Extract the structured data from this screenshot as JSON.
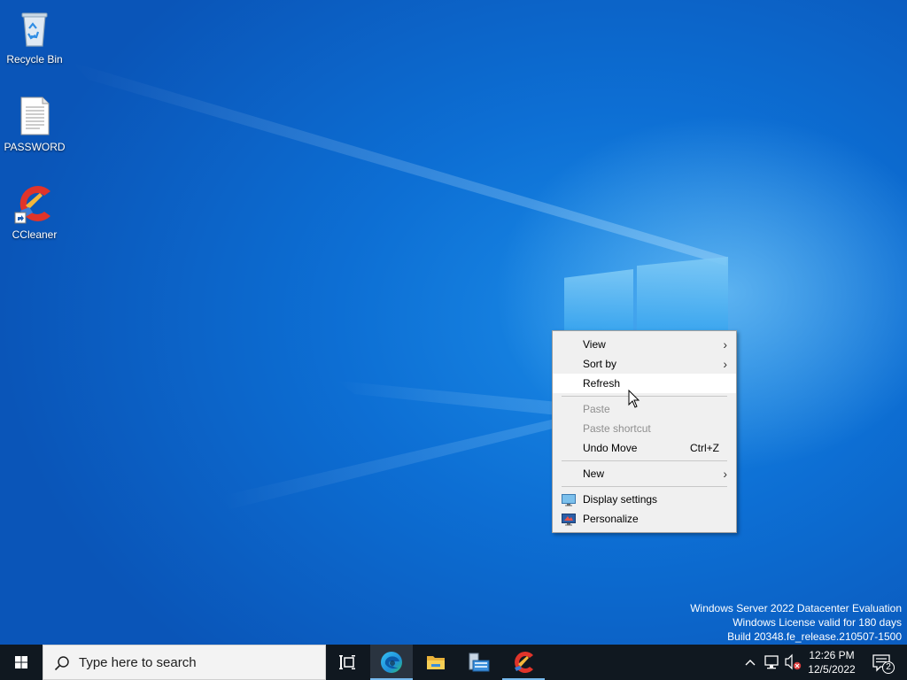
{
  "desktop": {
    "icons": [
      {
        "label": "Recycle Bin",
        "icon": "recycle-bin-icon"
      },
      {
        "label": "PASSWORD",
        "icon": "text-document-icon"
      },
      {
        "label": "CCleaner",
        "icon": "ccleaner-icon"
      }
    ]
  },
  "context_menu": {
    "items": [
      {
        "label": "View",
        "submenu": true
      },
      {
        "label": "Sort by",
        "submenu": true
      },
      {
        "label": "Refresh",
        "state": "hovered"
      },
      {
        "label": "Paste",
        "state": "disabled"
      },
      {
        "label": "Paste shortcut",
        "state": "disabled"
      },
      {
        "label": "Undo Move",
        "shortcut": "Ctrl+Z"
      },
      {
        "label": "New",
        "submenu": true
      },
      {
        "label": "Display settings",
        "icon": "display-icon"
      },
      {
        "label": "Personalize",
        "icon": "personalize-icon"
      }
    ]
  },
  "watermark": {
    "line1": "Windows Server 2022 Datacenter Evaluation",
    "line2": "Windows License valid for 180 days",
    "line3": "Build 20348.fe_release.210507-1500"
  },
  "taskbar": {
    "search_placeholder": "Type here to search",
    "pinned": [
      "task-view",
      "microsoft-edge",
      "file-explorer",
      "server-manager",
      "ccleaner"
    ],
    "active_app": "microsoft-edge",
    "clock": {
      "time": "12:26 PM",
      "date": "12/5/2022"
    },
    "notification_count": "2"
  },
  "colors": {
    "taskbar": "#101820",
    "menu_bg": "#f0f0f0",
    "menu_hover": "#ffffff",
    "disabled_text": "#8f8f8f",
    "accent": "#76b9ed"
  }
}
